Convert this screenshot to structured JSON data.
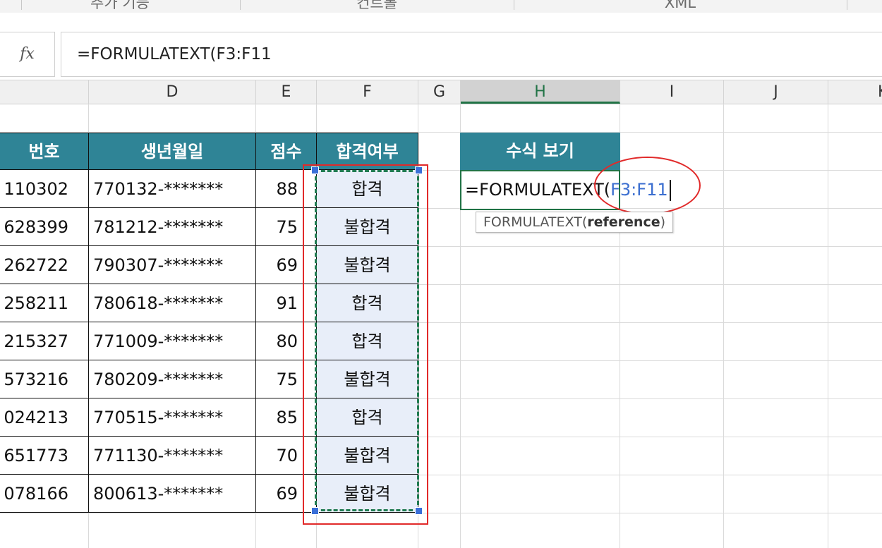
{
  "ribbon": {
    "groups": [
      "추가 기능",
      "컨트롤",
      "XML"
    ]
  },
  "formula_bar": {
    "fx_label": "fx",
    "formula": "=FORMULATEXT(F3:F11"
  },
  "columns": [
    "D",
    "E",
    "F",
    "G",
    "H",
    "I",
    "J",
    "K"
  ],
  "table": {
    "headers": {
      "c": "번호",
      "d": "생년월일",
      "e": "점수",
      "f": "합격여부"
    },
    "rows": [
      {
        "c": "110302",
        "d": "770132-*******",
        "e": "88",
        "f": "합격"
      },
      {
        "c": "628399",
        "d": "781212-*******",
        "e": "75",
        "f": "불합격"
      },
      {
        "c": "262722",
        "d": "790307-*******",
        "e": "69",
        "f": "불합격"
      },
      {
        "c": "258211",
        "d": "780618-*******",
        "e": "91",
        "f": "합격"
      },
      {
        "c": "215327",
        "d": "771009-*******",
        "e": "80",
        "f": "합격"
      },
      {
        "c": "573216",
        "d": "780209-*******",
        "e": "75",
        "f": "불합격"
      },
      {
        "c": "024213",
        "d": "770515-*******",
        "e": "85",
        "f": "합격"
      },
      {
        "c": "651773",
        "d": "771130-*******",
        "e": "70",
        "f": "불합격"
      },
      {
        "c": "078166",
        "d": "800613-*******",
        "e": "69",
        "f": "불합격"
      }
    ]
  },
  "formula_view": {
    "header": "수식 보기",
    "text_prefix": "=FORMULATEXT(",
    "text_ref": "F3:F11"
  },
  "tooltip": {
    "prefix": "FORMULATEXT(",
    "arg": "reference",
    "suffix": ")"
  },
  "colors": {
    "header_fill": "#2f8496",
    "selection_fill": "#e8eef9",
    "annotation_red": "#e12a2a",
    "excel_green": "#217346",
    "reference_blue": "#3c6fd0"
  }
}
